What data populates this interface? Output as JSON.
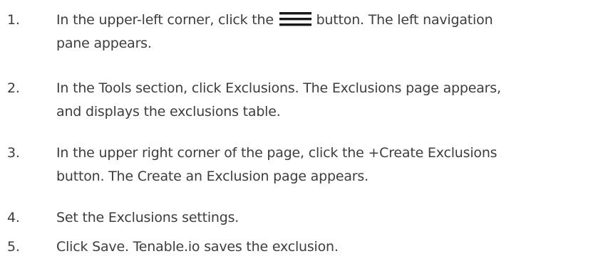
{
  "steps": [
    {
      "number": "1.",
      "text_before_icon": "In the upper-left corner, click the",
      "icon": "hamburger-menu-icon",
      "text_after_icon": "button. The left navigation",
      "line2": "pane appears."
    },
    {
      "number": "2.",
      "line1": "In the Tools section, click Exclusions. The Exclusions page appears,",
      "line2": "and displays the exclusions table."
    },
    {
      "number": "3.",
      "line1": "In the upper right corner of the page, click the +Create Exclusions",
      "line2": "button. The Create an Exclusion page appears."
    },
    {
      "number": "4.",
      "line1": "Set the Exclusions settings."
    },
    {
      "number": "5.",
      "line1": "Click Save. Tenable.io saves the exclusion."
    }
  ],
  "colors": {
    "text": "#3d3d3d",
    "icon": "#1a1a1a"
  }
}
